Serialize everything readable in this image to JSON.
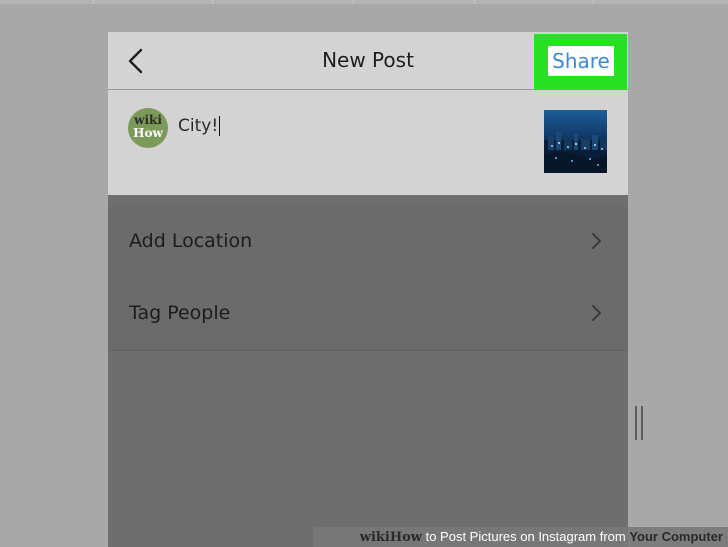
{
  "header": {
    "title": "New Post",
    "share_label": "Share",
    "back_icon": "chevron-left-icon"
  },
  "post": {
    "caption": "City!",
    "avatar": {
      "top": "wiki",
      "bottom": "How"
    },
    "thumbnail": "city-night-photo"
  },
  "options": [
    {
      "label": "Add Location",
      "icon": "chevron-right-icon"
    },
    {
      "label": "Tag People",
      "icon": "chevron-right-icon"
    }
  ],
  "watermark": {
    "wiki": "wiki",
    "how": "How",
    "middle": " to Post Pictures on Instagram from ",
    "strong": "Your Computer"
  },
  "colors": {
    "highlight": "#28e022",
    "share_text": "#3a8ad6",
    "header_bg": "#d3d3d3",
    "list_bg": "#6b6b6b"
  }
}
